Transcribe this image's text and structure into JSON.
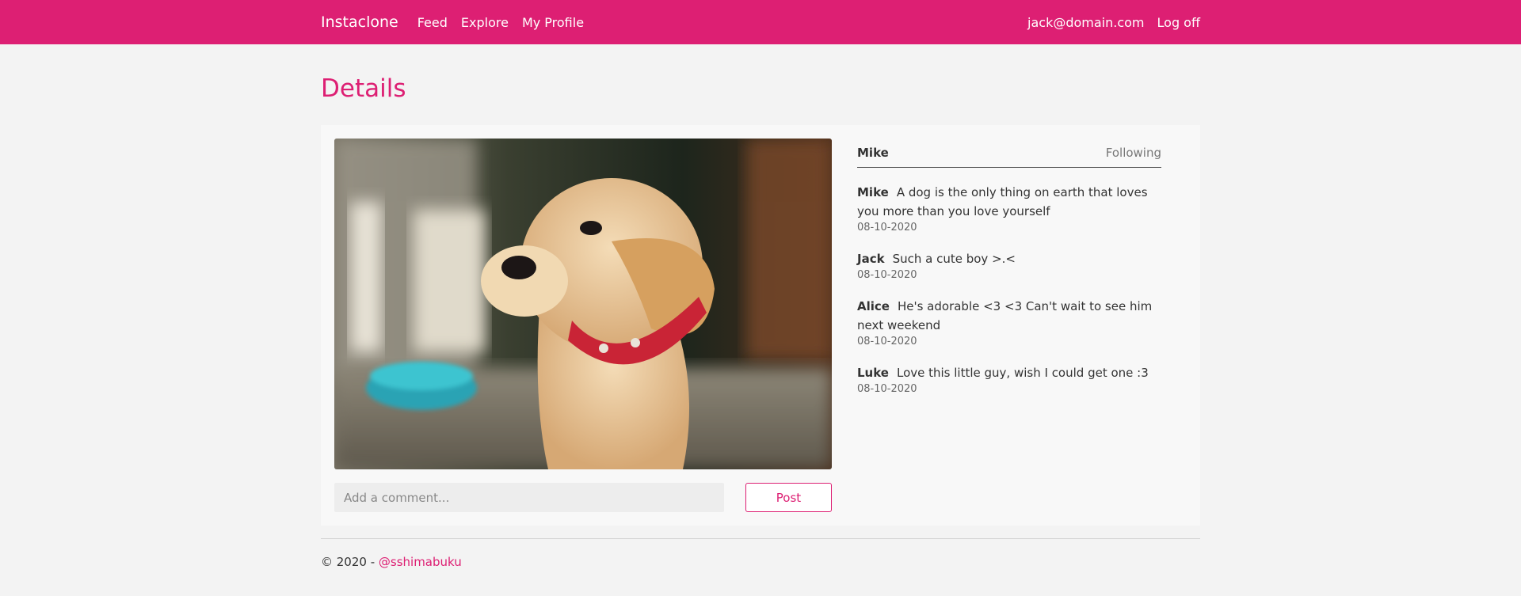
{
  "nav": {
    "brand": "Instaclone",
    "links": [
      "Feed",
      "Explore",
      "My Profile"
    ],
    "user_email": "jack@domain.com",
    "logoff": "Log off"
  },
  "page": {
    "title": "Details"
  },
  "post": {
    "author": "Mike",
    "follow_status": "Following",
    "comments": [
      {
        "user": "Mike",
        "text": "A dog is the only thing on earth that loves you more than you love yourself",
        "date": "08-10-2020"
      },
      {
        "user": "Jack",
        "text": "Such a cute boy >.<",
        "date": "08-10-2020"
      },
      {
        "user": "Alice",
        "text": "He's adorable <3 <3 Can't wait to see him next weekend",
        "date": "08-10-2020"
      },
      {
        "user": "Luke",
        "text": "Love this little guy, wish I could get one :3",
        "date": "08-10-2020"
      }
    ],
    "comment_placeholder": "Add a comment...",
    "post_label": "Post"
  },
  "footer": {
    "copyright": "© 2020 - ",
    "link": "@sshimabuku"
  },
  "colors": {
    "accent": "#dd1f73",
    "background": "#f3f3f3"
  }
}
